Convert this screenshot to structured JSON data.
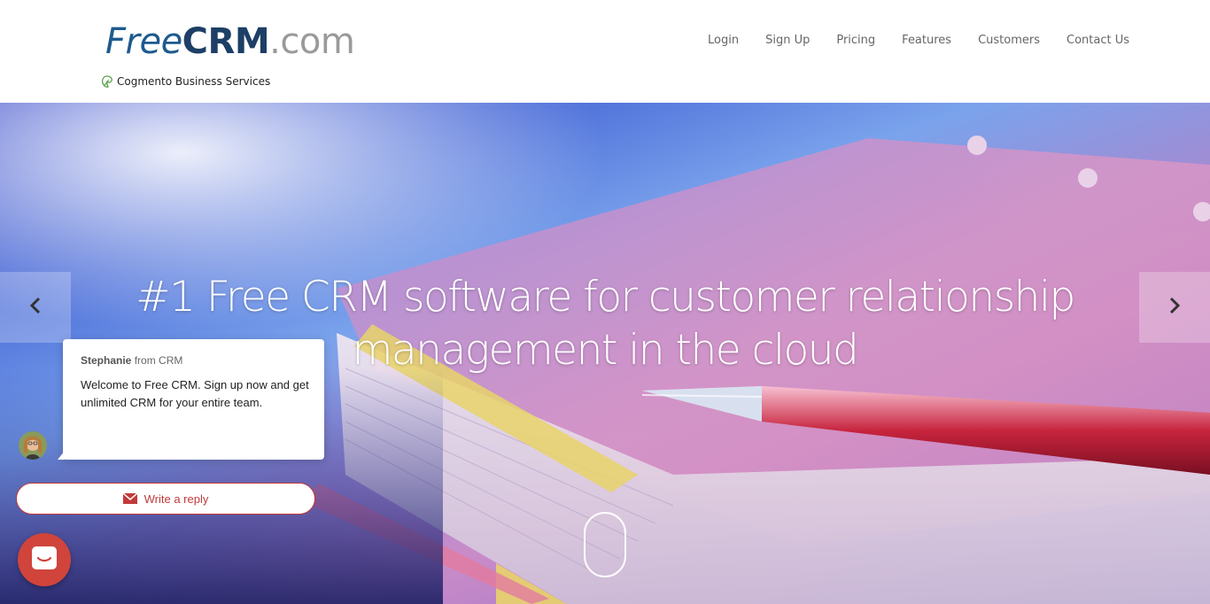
{
  "header": {
    "logo": {
      "free": "Free",
      "crm": "CRM",
      "dotcom": ".com"
    },
    "sublogo": "Cogmento Business Services"
  },
  "nav": {
    "items": [
      {
        "label": "Login"
      },
      {
        "label": "Sign Up"
      },
      {
        "label": "Pricing"
      },
      {
        "label": "Features"
      },
      {
        "label": "Customers"
      },
      {
        "label": "Contact Us"
      }
    ]
  },
  "hero": {
    "headline": "#1 Free CRM software for customer relationship management in the cloud",
    "prev_icon": "chevron-left-icon",
    "next_icon": "chevron-right-icon"
  },
  "chat": {
    "agent_name": "Stephanie",
    "from_text": "from CRM",
    "message": "Welcome to Free CRM.  Sign up now and get unlimited CRM for your entire team.",
    "reply_label": "Write a reply",
    "accent_color": "#c03a3a",
    "launcher_color": "#d0443c"
  },
  "colors": {
    "logo_primary": "#1d5a8e",
    "logo_secondary": "#9a9a9a",
    "nav_text": "#666666"
  }
}
